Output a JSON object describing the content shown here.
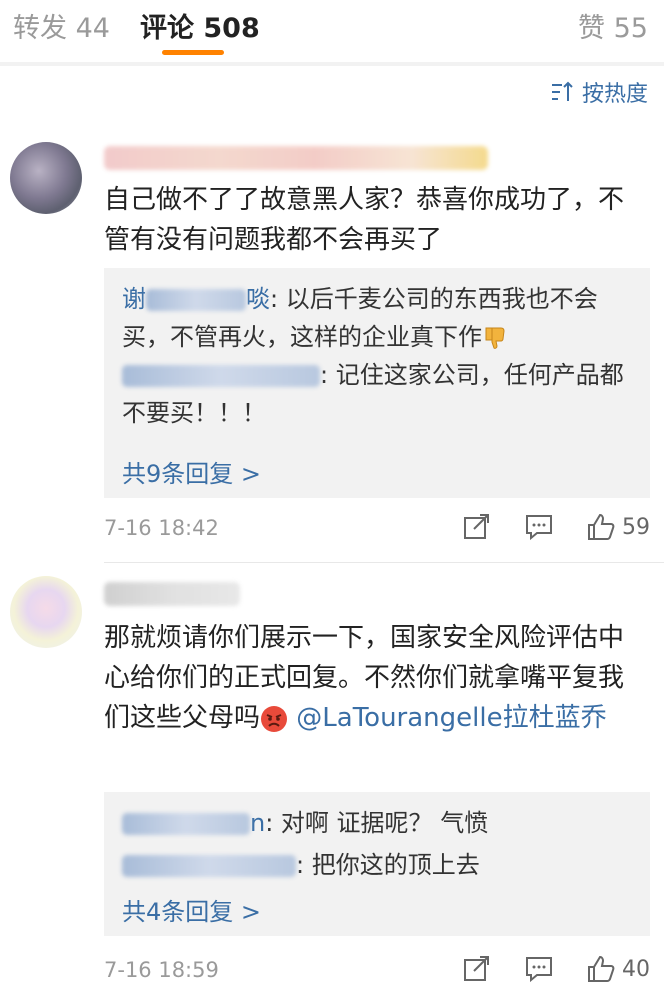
{
  "tabs": {
    "repost": "转发 44",
    "comment": "评论 508",
    "like": "赞 55"
  },
  "sort": {
    "label": "按热度",
    "icon": "sort-icon"
  },
  "comments": [
    {
      "text": "自己做不了了故意黑人家？恭喜你成功了，不管有没有问题我都不会再买了",
      "replies": [
        {
          "name_suffix": "谢",
          "name_end": "啖",
          "text": ": 以后千麦公司的东西我也不会买，不管再火，这样的企业真下作"
        },
        {
          "name_suffix": "",
          "name_end": "",
          "text": ": 记住这家公司，任何产品都不要买！！！"
        }
      ],
      "more": "共9条回复 >",
      "time": "7-16 18:42",
      "likes": "59"
    },
    {
      "text_before": "那就烦请你们展示一下，国家安全风险评估中心给你们的正式回复。不然你们就拿嘴平复我们这些父母吗",
      "mention": "@LaTourangelle拉杜蓝乔",
      "replies": [
        {
          "name_end": "n",
          "text": ": 对啊 证据呢？ 气愤"
        },
        {
          "name_end": "",
          "text": ": 把你这的顶上去"
        }
      ],
      "more": "共4条回复 >",
      "time": "7-16 18:59",
      "likes": "40"
    }
  ]
}
